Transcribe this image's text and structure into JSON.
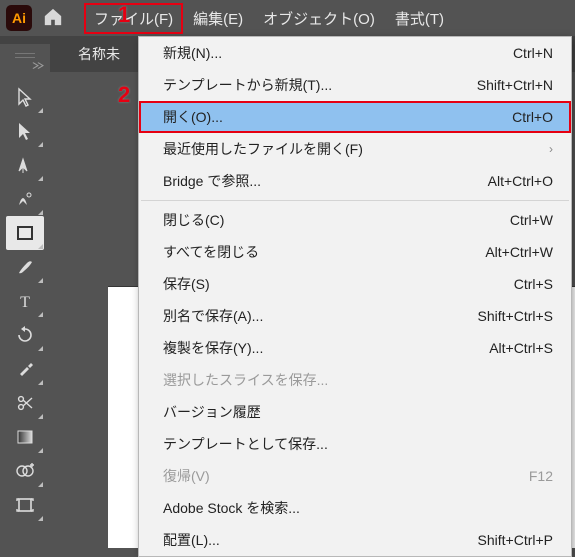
{
  "app": {
    "logo_text": "Ai"
  },
  "menubar": {
    "file": "ファイル(F)",
    "edit": "編集(E)",
    "object": "オブジェクト(O)",
    "type": "書式(T)"
  },
  "tab": {
    "label": "名称未"
  },
  "annotations": {
    "one": "1",
    "two": "2"
  },
  "dropdown": {
    "items": [
      {
        "label": "新規(N)...",
        "shortcut": "Ctrl+N",
        "enabled": true
      },
      {
        "label": "テンプレートから新規(T)...",
        "shortcut": "Shift+Ctrl+N",
        "enabled": true
      },
      {
        "label": "開く(O)...",
        "shortcut": "Ctrl+O",
        "enabled": true,
        "highlight": true
      },
      {
        "label": "最近使用したファイルを開く(F)",
        "submenu": true,
        "enabled": true
      },
      {
        "label": "Bridge で参照...",
        "shortcut": "Alt+Ctrl+O",
        "enabled": true
      },
      {
        "sep": true
      },
      {
        "label": "閉じる(C)",
        "shortcut": "Ctrl+W",
        "enabled": true
      },
      {
        "label": "すべてを閉じる",
        "shortcut": "Alt+Ctrl+W",
        "enabled": true
      },
      {
        "label": "保存(S)",
        "shortcut": "Ctrl+S",
        "enabled": true
      },
      {
        "label": "別名で保存(A)...",
        "shortcut": "Shift+Ctrl+S",
        "enabled": true
      },
      {
        "label": "複製を保存(Y)...",
        "shortcut": "Alt+Ctrl+S",
        "enabled": true
      },
      {
        "label": "選択したスライスを保存...",
        "enabled": false
      },
      {
        "label": "バージョン履歴",
        "enabled": true
      },
      {
        "label": "テンプレートとして保存...",
        "enabled": true
      },
      {
        "label": "復帰(V)",
        "shortcut": "F12",
        "enabled": false
      },
      {
        "label": "Adobe Stock を検索...",
        "enabled": true
      },
      {
        "label": "配置(L)...",
        "shortcut": "Shift+Ctrl+P",
        "enabled": true
      }
    ]
  },
  "tools": [
    {
      "name": "selection-tool"
    },
    {
      "name": "direct-selection-tool"
    },
    {
      "name": "pen-tool"
    },
    {
      "name": "curvature-tool"
    },
    {
      "name": "rectangle-tool",
      "selected": true
    },
    {
      "name": "paintbrush-tool"
    },
    {
      "name": "type-tool"
    },
    {
      "name": "rotate-tool"
    },
    {
      "name": "eyedropper-tool"
    },
    {
      "name": "scissors-tool"
    },
    {
      "name": "gradient-tool"
    },
    {
      "name": "shape-builder-tool"
    },
    {
      "name": "artboard-tool"
    }
  ]
}
